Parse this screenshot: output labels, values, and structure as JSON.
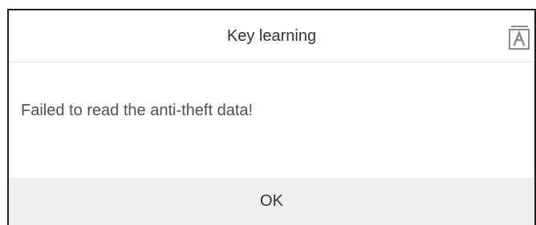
{
  "dialog": {
    "title": "Key learning",
    "message": "Failed to read the anti-theft data!",
    "ok_label": "OK",
    "header_icon": "translate-icon"
  },
  "colors": {
    "frame": "#1e1e1e",
    "footer_bg": "#efefef",
    "text": "#333333",
    "message_text": "#505050"
  }
}
